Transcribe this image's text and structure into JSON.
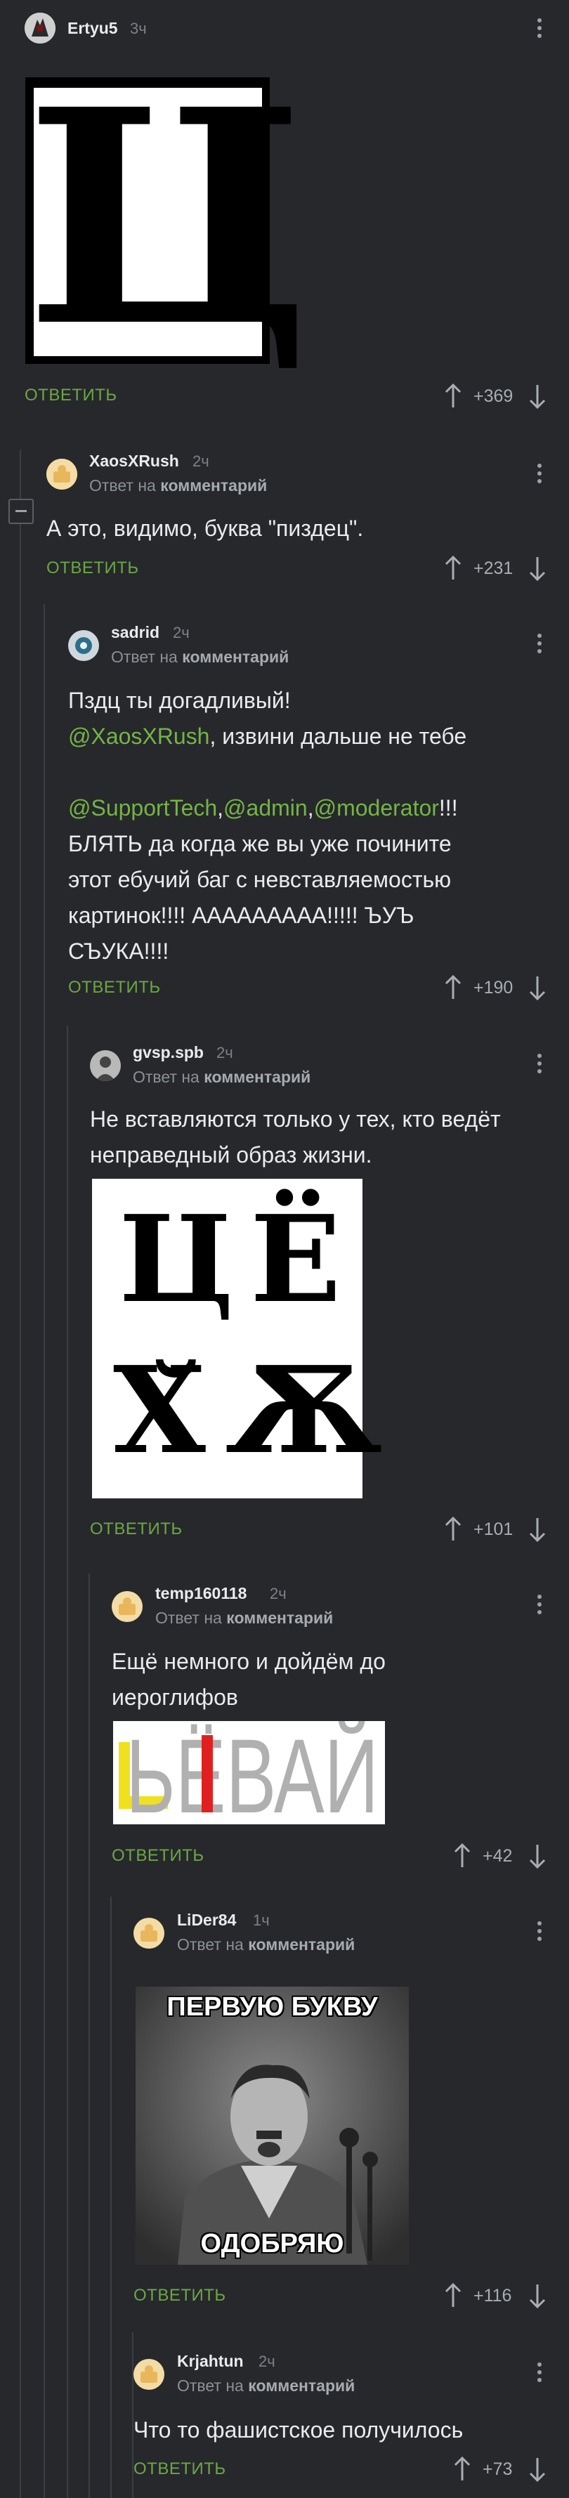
{
  "comments": [
    {
      "username": "Ertyu5",
      "time": "3ч",
      "image_text": "Ц",
      "reply_label": "ОТВЕТИТЬ",
      "rating": "+369"
    },
    {
      "username": "XaosXRush",
      "time": "2ч",
      "reply_to_prefix": "Ответ на",
      "reply_to_target": "комментарий",
      "body_lines": [
        "А это, видимо, буква \"пиздец\"."
      ],
      "reply_label": "ОТВЕТИТЬ",
      "rating": "+231"
    },
    {
      "username": "sadrid",
      "time": "2ч",
      "reply_to_prefix": "Ответ на",
      "reply_to_target": "комментарий",
      "body_line1": "Пздц ты догадливый!",
      "mention1": "@XaosXRush",
      "body_line2_rest": ", извини дальше не тебе",
      "mention2": "@SupportTech",
      "sep1": ",",
      "mention3": "@admin",
      "sep2": ",",
      "mention4": "@moderator",
      "body_line3_rest": "!!!",
      "body_line4": "БЛЯТЬ да когда же вы уже почините",
      "body_line5": "этот ебучий баг с невставляемостью",
      "body_line6": "картинок!!!! ААААААААА!!!!! ЪУЪ",
      "body_line7": "СЪУКА!!!!",
      "reply_label": "ОТВЕТИТЬ",
      "rating": "+190"
    },
    {
      "username": "gvsp.spb",
      "time": "2ч",
      "reply_to_prefix": "Ответ на",
      "reply_to_target": "комментарий",
      "body_line1": "Не вставляются только у тех, кто ведёт",
      "body_line2": "неправедный образ жизни.",
      "image_letters": [
        "Ц",
        "Ё",
        "Ѫ",
        "Ѫ"
      ],
      "image_letter_h": "Х̆",
      "reply_label": "ОТВЕТИТЬ",
      "rating": "+101"
    },
    {
      "username": "temp160118",
      "time": "2ч",
      "reply_to_prefix": "Ответ на",
      "reply_to_target": "комментарий",
      "body_line1": "Ещё немного и дойдём до",
      "body_line2": "иероглифов",
      "image_text": "ЬЁВАЙ",
      "reply_label": "ОТВЕТИТЬ",
      "rating": "+42"
    },
    {
      "username": "LiDer84",
      "time": "1ч",
      "reply_to_prefix": "Ответ на",
      "reply_to_target": "комментарий",
      "image_top": "ПЕРВУЮ БУКВУ",
      "image_bottom": "ОДОБРЯЮ",
      "reply_label": "ОТВЕТИТЬ",
      "rating": "+116"
    },
    {
      "username": "Krjahtun",
      "time": "2ч",
      "reply_to_prefix": "Ответ на",
      "reply_to_target": "комментарий",
      "body_line1": "Что то фашистское получилось",
      "reply_label": "ОТВЕТИТЬ",
      "rating": "+73"
    }
  ],
  "colors": {
    "background": "#26282b",
    "accent_green": "#6ba744",
    "mention_green": "#74b446",
    "muted_text": "#8c9096",
    "thread_line": "#3b3e43"
  },
  "icons": [
    "upvote-arrow-icon",
    "downvote-arrow-icon",
    "more-dots-icon",
    "collapse-minus-icon"
  ]
}
